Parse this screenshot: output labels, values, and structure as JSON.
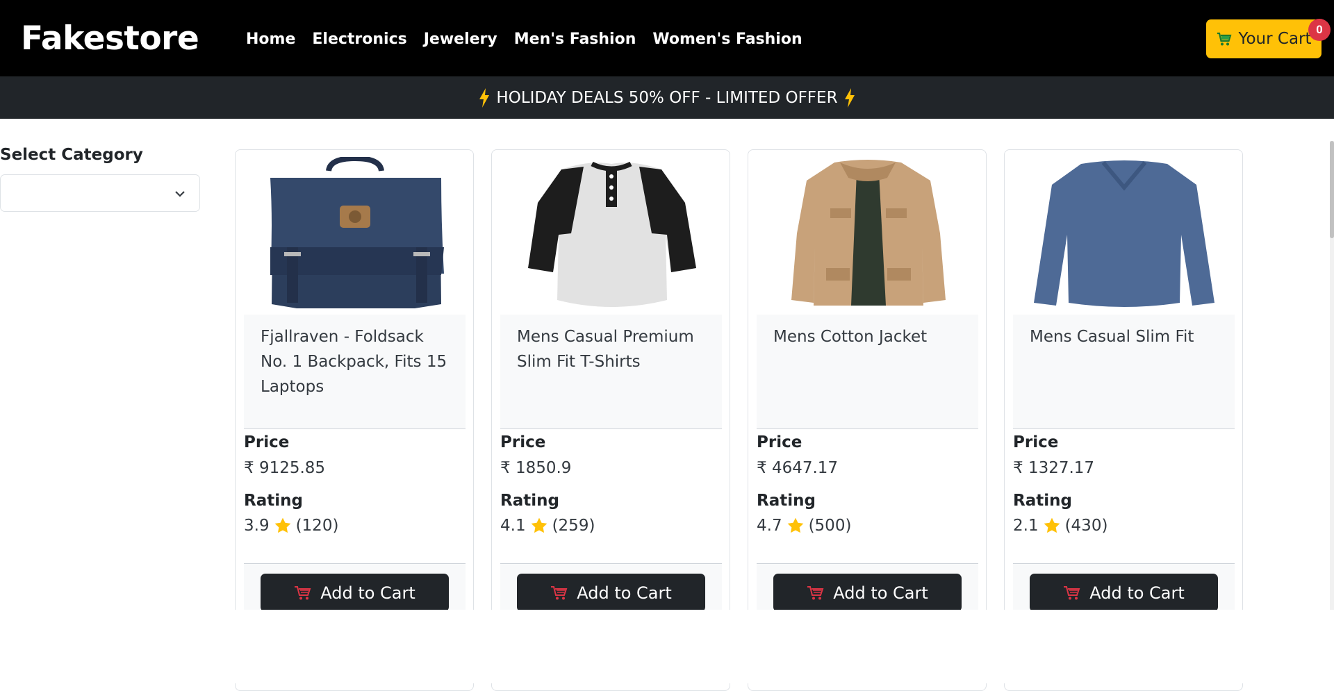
{
  "header": {
    "brand": "Fakestore",
    "nav": [
      "Home",
      "Electronics",
      "Jewelery",
      "Men's Fashion",
      "Women's Fashion"
    ],
    "cart_label": "Your Cart",
    "cart_count": "0",
    "cart_icon": "shopping-cart-icon"
  },
  "promo": {
    "text": "HOLIDAY DEALS 50% OFF - LIMITED OFFER",
    "icon": "lightning-bolt-icon"
  },
  "sidebar": {
    "label": "Select Category",
    "selected": ""
  },
  "labels": {
    "price": "Price",
    "rating": "Rating",
    "add_to_cart": "Add to Cart"
  },
  "products": [
    {
      "title": "Fjallraven - Foldsack No. 1 Backpack, Fits 15 Laptops",
      "price": "₹ 9125.85",
      "rating": "3.9",
      "count": "(120)",
      "image": "backpack"
    },
    {
      "title": "Mens Casual Premium Slim Fit T-Shirts",
      "price": "₹ 1850.9",
      "rating": "4.1",
      "count": "(259)",
      "image": "raglan-tshirt"
    },
    {
      "title": "Mens Cotton Jacket",
      "price": "₹ 4647.17",
      "rating": "4.7",
      "count": "(500)",
      "image": "jacket"
    },
    {
      "title": "Mens Casual Slim Fit",
      "price": "₹ 1327.17",
      "rating": "2.1",
      "count": "(430)",
      "image": "longsleeve-shirt"
    }
  ],
  "colors": {
    "navbar": "#000000",
    "promo": "#212529",
    "cart_button": "#ffc107",
    "badge": "#dc3545",
    "star": "#ffc107"
  }
}
